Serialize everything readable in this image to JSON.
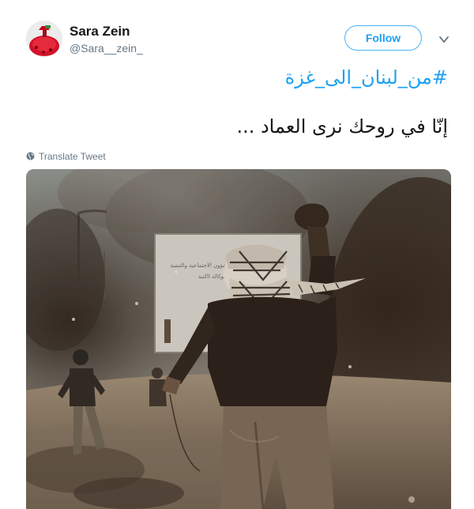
{
  "user": {
    "display_name": "Sara Zein",
    "handle": "@Sara__zein_"
  },
  "actions": {
    "follow_label": "Follow",
    "menu_icon": "chevron-down-icon"
  },
  "tweet": {
    "hashtag": "#من_لبنان_الى_غزة",
    "text": "إنّا في روحك نرى العماد ...",
    "translate_label": "Translate Tweet"
  },
  "media": {
    "type": "photo",
    "sign_lines": [
      "وزارة الشؤون الاجتماعية والتنمية",
      "الوكالة ااكنية"
    ]
  },
  "colors": {
    "accent": "#1da1f2",
    "follow_border": "#4ab3f4",
    "text": "#14171a",
    "muted": "#657786"
  }
}
